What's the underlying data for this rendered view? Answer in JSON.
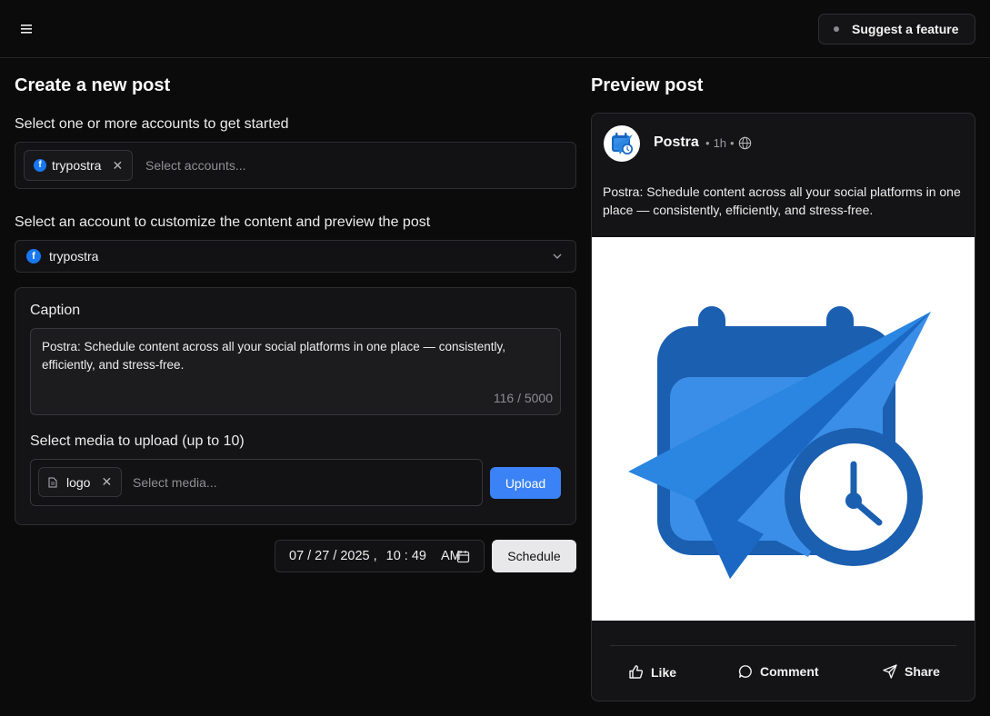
{
  "header": {
    "menu_icon": "hamburger-menu-icon",
    "suggest_label": "Suggest a feature"
  },
  "create": {
    "title": "Create a new post",
    "accounts_label": "Select one or more accounts to get started",
    "selected_accounts": [
      {
        "name": "trypostra",
        "icon": "facebook-icon"
      }
    ],
    "accounts_placeholder": "Select accounts...",
    "customize_label": "Select an account to customize the content and preview the post",
    "customize_selected": "trypostra",
    "caption_label": "Caption",
    "caption_text": "Postra: Schedule content across all your social platforms in one place — consistently, efficiently, and stress-free.",
    "caption_counter": "116 / 5000",
    "media_label": "Select media to upload (up to 10)",
    "media_chip": "logo",
    "media_placeholder": "Select media...",
    "upload_label": "Upload",
    "date": {
      "month": "07",
      "day": "27",
      "year": "2025",
      "hour": "10",
      "minute": "49",
      "ampm": "AM"
    },
    "schedule_label": "Schedule"
  },
  "preview": {
    "title": "Preview post",
    "account_name": "Postra",
    "time": "1h",
    "post_text": "Postra: Schedule content across all your social platforms in one place — consistently, efficiently, and stress-free.",
    "actions": {
      "like": "Like",
      "comment": "Comment",
      "share": "Share"
    }
  },
  "colors": {
    "accent": "#3b82f6",
    "facebook": "#1877f2",
    "logo_dark": "#1565c0",
    "logo_light": "#3b8ee8"
  }
}
